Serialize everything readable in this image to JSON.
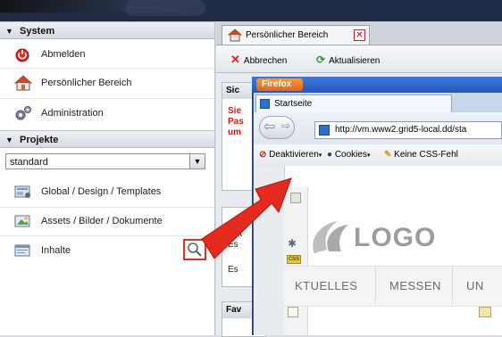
{
  "left_panel": {
    "system_header": "System",
    "system_items": [
      {
        "label": "Abmelden",
        "icon": "power-icon"
      },
      {
        "label": "Persönlicher Bereich",
        "icon": "home-icon"
      },
      {
        "label": "Administration",
        "icon": "gears-icon"
      }
    ],
    "projects_header": "Projekte",
    "project_select": "standard",
    "project_items": [
      {
        "label": "Global / Design / Templates",
        "icon": "templates-icon"
      },
      {
        "label": "Assets / Bilder / Dokumente",
        "icon": "assets-icon"
      },
      {
        "label": "Inhalte",
        "icon": "content-icon"
      }
    ]
  },
  "tabs": [
    {
      "label": "Persönlicher Bereich"
    }
  ],
  "toolbar": {
    "cancel_label": "Abbrechen",
    "refresh_label": "Aktualisieren"
  },
  "background_panel": {
    "title_frag": "Sic",
    "red_lines": [
      "Sie",
      "Pas",
      "um"
    ],
    "install_frag": [
      "Inst",
      "Es"
    ],
    "es_frag": "Es",
    "fav_frag": "Fav"
  },
  "firefox": {
    "menu_label": "Firefox",
    "tab_label": "Startseite",
    "url": "http://vm.www2.grid5-local.dd/sta",
    "addons": {
      "deactivate": "Deaktivieren",
      "cookies": "Cookies",
      "css": "Keine CSS-Fehl"
    }
  },
  "webpage": {
    "logo_text": "LOGO",
    "nav": [
      "KTUELLES",
      "MESSEN",
      "UN"
    ]
  },
  "colors": {
    "accent_red": "#d9342a",
    "firefox_blue": "#2b63c4",
    "firefox_orange": "#e8741f"
  }
}
